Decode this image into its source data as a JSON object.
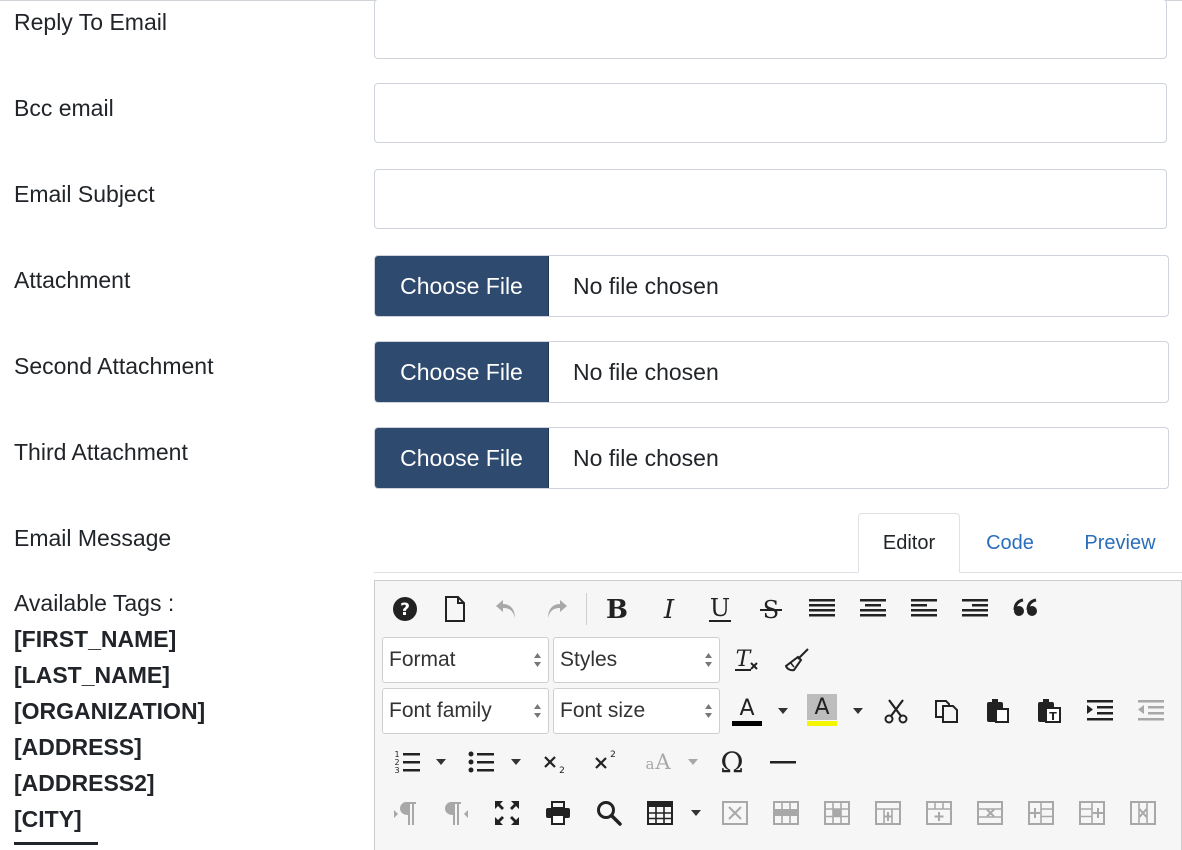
{
  "form": {
    "reply_to_label": "Reply To Email",
    "bcc_label": "Bcc email",
    "subject_label": "Email Subject",
    "attachment_label": "Attachment",
    "second_attachment_label": "Second Attachment",
    "third_attachment_label": "Third Attachment",
    "message_label": "Email Message",
    "reply_to_value": "",
    "bcc_value": "",
    "subject_value": ""
  },
  "file_inputs": [
    {
      "button": "Choose File",
      "status": "No file chosen"
    },
    {
      "button": "Choose File",
      "status": "No file chosen"
    },
    {
      "button": "Choose File",
      "status": "No file chosen"
    }
  ],
  "tabs": [
    {
      "label": "Editor",
      "active": true
    },
    {
      "label": "Code",
      "active": false
    },
    {
      "label": "Preview",
      "active": false
    }
  ],
  "editor": {
    "format_select": "Format",
    "styles_select": "Styles",
    "font_family_select": "Font family",
    "font_size_select": "Font size",
    "text_color_glyph": "A",
    "bg_color_glyph": "A",
    "text_color": "#000000",
    "bg_color": "#f5f500"
  },
  "tags": {
    "title": "Available Tags :",
    "items": [
      "[FIRST_NAME]",
      "[LAST_NAME]",
      "[ORGANIZATION]",
      "[ADDRESS]",
      "[ADDRESS2]",
      "[CITY]"
    ]
  },
  "colors": {
    "file_button": "#2e4a6e",
    "link": "#2a6ebb"
  }
}
